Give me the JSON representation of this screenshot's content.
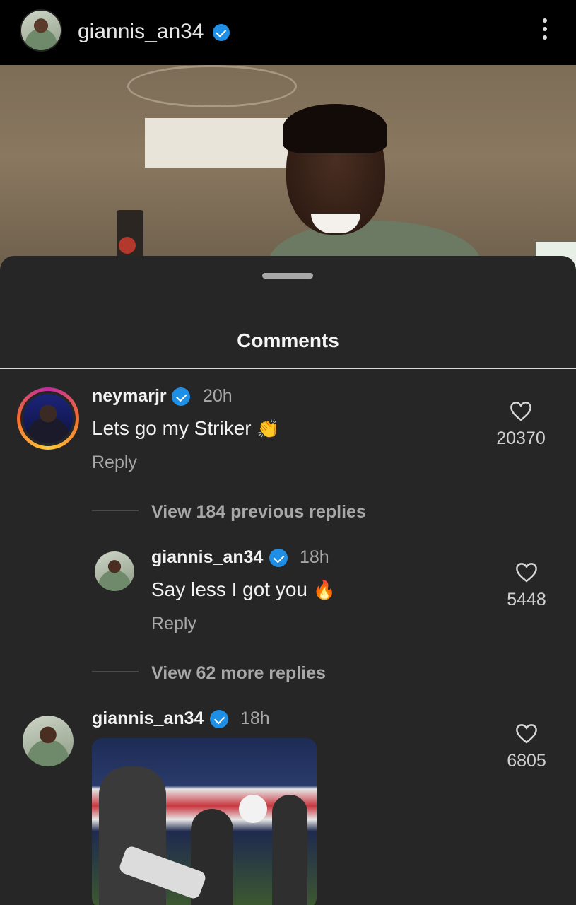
{
  "header": {
    "username": "giannis_an34",
    "verified": true
  },
  "sheet": {
    "title": "Comments"
  },
  "comments": [
    {
      "username": "neymarjr",
      "time": "20h",
      "text": "Lets go my Striker",
      "emoji": "👏",
      "reply_label": "Reply",
      "likes": "20370"
    },
    {
      "username": "giannis_an34",
      "time": "18h",
      "text": "Say less I got you",
      "emoji": "🔥",
      "reply_label": "Reply",
      "likes": "5448"
    },
    {
      "username": "giannis_an34",
      "time": "18h",
      "likes": "6805"
    }
  ],
  "threads": {
    "view_previous": "View 184 previous replies",
    "view_more": "View 62 more replies"
  },
  "colors": {
    "background": "#000000",
    "sheet": "#262626",
    "verified": "#1f8fe6",
    "muted_text": "#a8a8a8"
  },
  "icons": [
    "more-vertical-icon",
    "verified-badge-icon",
    "heart-icon"
  ]
}
